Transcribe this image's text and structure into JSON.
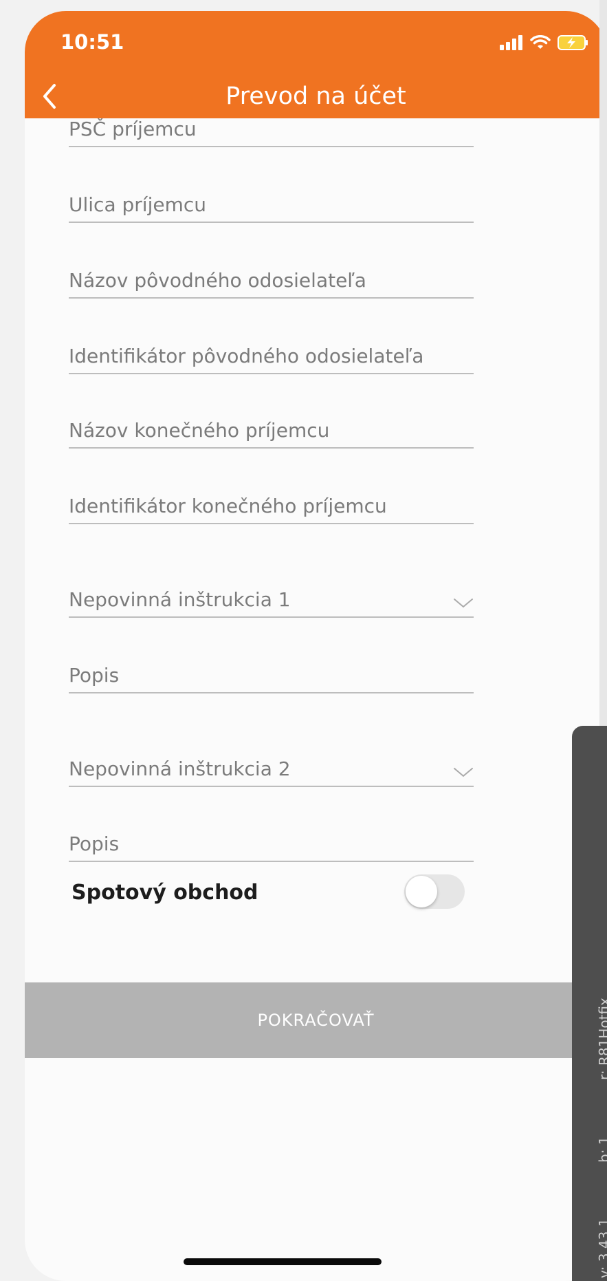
{
  "status_bar": {
    "time": "10:51"
  },
  "header": {
    "title": "Prevod na účet",
    "back_icon": "chevron-left-icon",
    "background_color": "#f07321"
  },
  "form": {
    "fields": [
      {
        "label": "PSČ príjemcu",
        "type": "text"
      },
      {
        "label": "Ulica príjemcu",
        "type": "text"
      },
      {
        "label": "Názov pôvodného odosielateľa",
        "type": "text"
      },
      {
        "label": "Identifikátor pôvodného odosielateľa",
        "type": "text"
      },
      {
        "label": "Názov konečného príjemcu",
        "type": "text"
      },
      {
        "label": "Identifikátor konečného príjemcu",
        "type": "text"
      },
      {
        "label": "Nepovinná inštrukcia 1",
        "type": "select"
      },
      {
        "label": "Popis",
        "type": "text"
      },
      {
        "label": "Nepovinná inštrukcia 2",
        "type": "select"
      },
      {
        "label": "Popis",
        "type": "text"
      }
    ],
    "toggle": {
      "label": "Spotový obchod",
      "on": false
    }
  },
  "footer": {
    "continue_label": "POKRAČOVAŤ",
    "button_color": "#b3b3b3"
  },
  "debug_overlay": {
    "texts": [
      "v: 3.43.1",
      "b: 1",
      "r: R81Hotfix"
    ]
  }
}
